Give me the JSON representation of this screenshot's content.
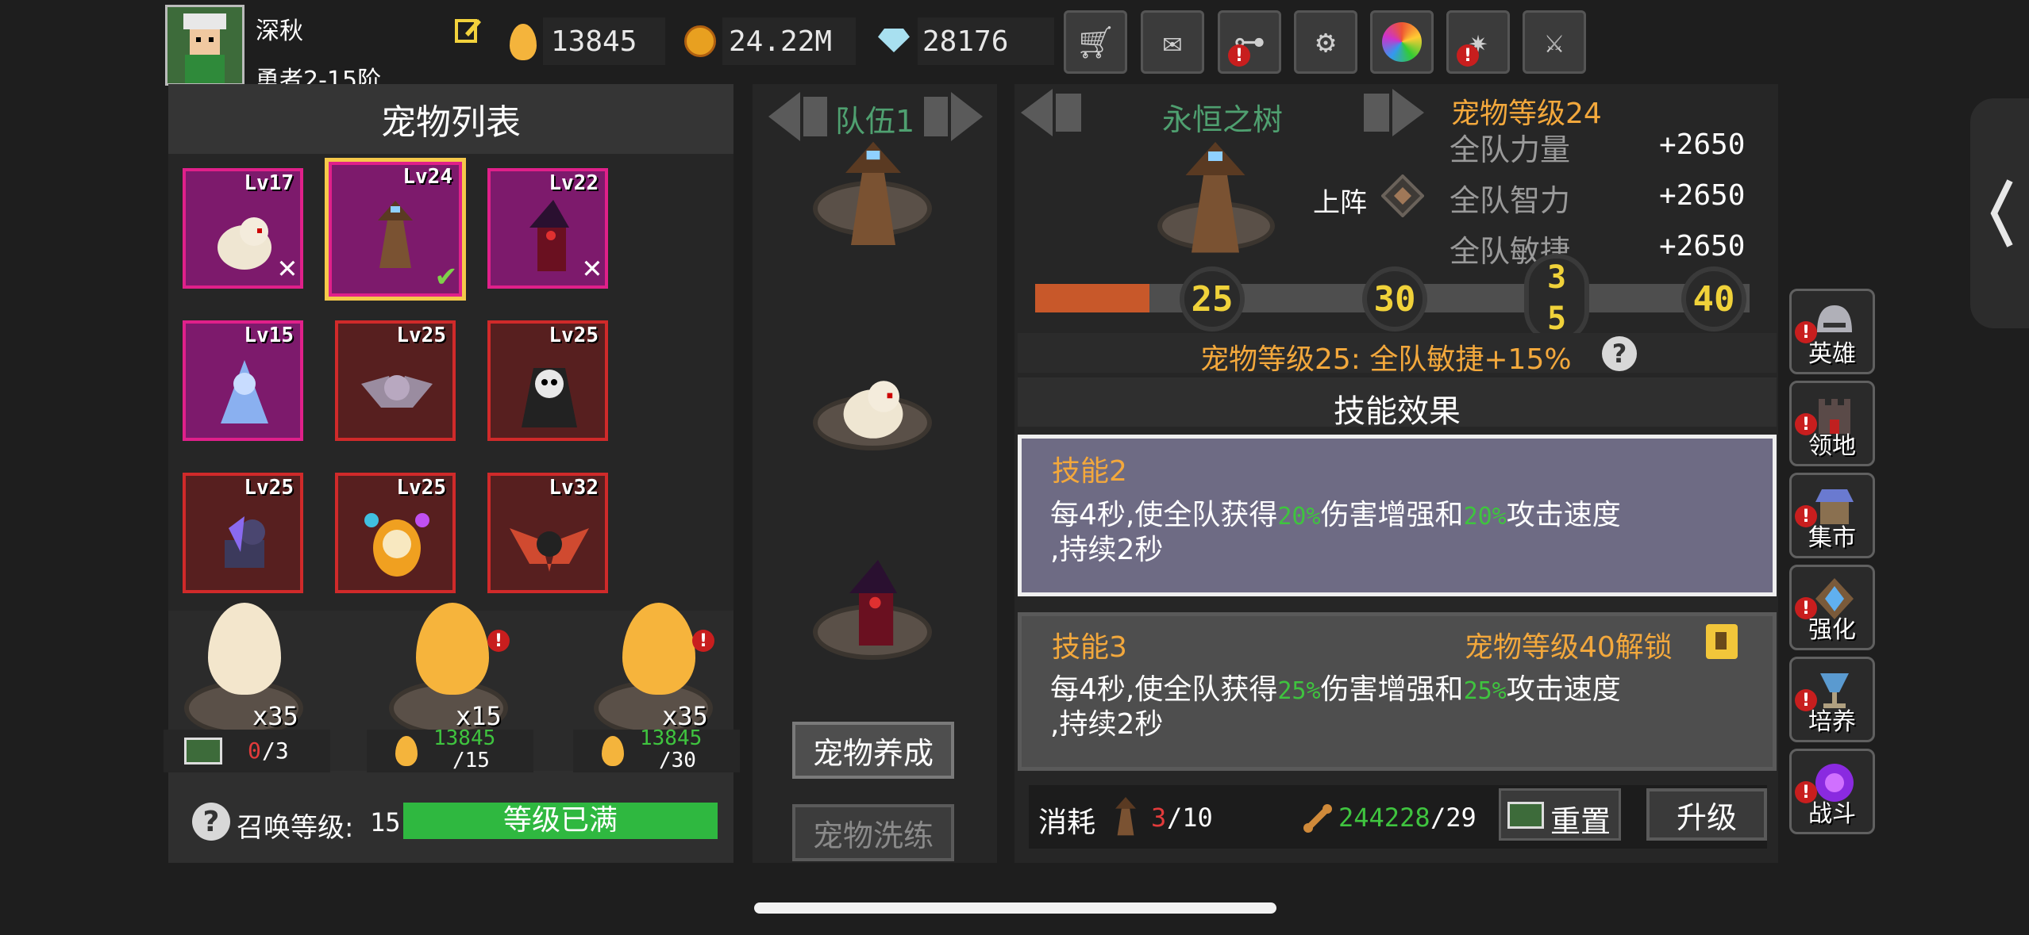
{
  "player": {
    "name": "深秋",
    "rank": "勇者2-15阶",
    "eggs": "13845",
    "gold": "24.22M",
    "gems": "28176"
  },
  "toolbar": {
    "icons": [
      "cart-icon",
      "mail-icon",
      "gamepad-icon",
      "gear-icon",
      "aperture-icon",
      "fireworks-icon",
      "swords-icon"
    ]
  },
  "pet_list": {
    "title": "宠物列表",
    "pets": [
      {
        "level": "Lv17",
        "equipped": false
      },
      {
        "level": "Lv24",
        "equipped": true
      },
      {
        "level": "Lv22",
        "equipped": false
      },
      {
        "level": "Lv15"
      },
      {
        "level": "Lv25"
      },
      {
        "level": "Lv25"
      },
      {
        "level": "Lv25"
      },
      {
        "level": "Lv25"
      },
      {
        "level": "Lv32"
      }
    ],
    "eggs": [
      {
        "count": "x35",
        "cost": "0",
        "limit": "/3"
      },
      {
        "count": "x15",
        "cost": "13845",
        "limit": "/15"
      },
      {
        "count": "x35",
        "cost": "13845",
        "limit": "/30"
      }
    ],
    "summon_label": "召唤等级:",
    "summon_level": "15",
    "summon_status": "等级已满"
  },
  "team": {
    "title": "队伍1",
    "train_button": "宠物养成",
    "reroll_button": "宠物洗练"
  },
  "pet_detail": {
    "name": "永恒之树",
    "level_text": "宠物等级24",
    "deploy_label": "上阵",
    "stats": [
      {
        "label": "全队力量",
        "value": "+2650"
      },
      {
        "label": "全队智力",
        "value": "+2650"
      },
      {
        "label": "全队敏捷",
        "value": "+2650"
      }
    ],
    "milestones": [
      "25",
      "30",
      "3\n5",
      "40"
    ],
    "progress_fraction": 0.16,
    "next_bonus": "宠物等级25: 全队敏捷+15%",
    "skills_title": "技能效果",
    "skill2": {
      "name": "技能2",
      "desc_a": "每4秒,使全队获得",
      "pct1": "20%",
      "desc_b": "伤害增强和",
      "pct2": "20%",
      "desc_c": "攻击速度",
      "desc_d": ",持续2秒"
    },
    "skill3": {
      "name": "技能3",
      "unlock": "宠物等级40解锁",
      "desc_a": "每4秒,使全队获得",
      "pct1": "25%",
      "desc_b": "伤害增强和",
      "pct2": "25%",
      "desc_c": "攻击速度",
      "desc_d": ",持续2秒"
    },
    "cost_label": "消耗",
    "cost_have": "3",
    "cost_need": "/10",
    "bones_have": "244228",
    "bones_need": "/29",
    "reset_button": "重置",
    "upgrade_button": "升级"
  },
  "side_nav": [
    {
      "label": "英雄"
    },
    {
      "label": "领地"
    },
    {
      "label": "集市"
    },
    {
      "label": "强化"
    },
    {
      "label": "培养"
    },
    {
      "label": "战斗"
    }
  ],
  "colors": {
    "accent_orange": "#f3a83c",
    "green": "#3fc43f",
    "pink_border": "#e0208a",
    "red_border": "#d02a2a"
  }
}
